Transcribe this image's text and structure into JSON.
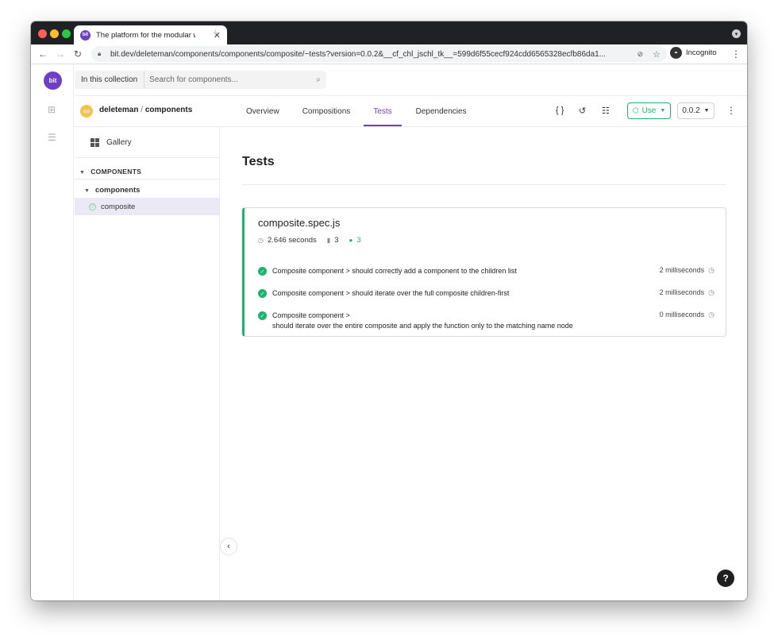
{
  "browser": {
    "tab_title": "The platform for the modular w",
    "tab_favicon": "bit",
    "url": "bit.dev/deleteman/components/components/composite/~tests?version=0.0.2&__cf_chl_jschl_tk__=599d6f55cecf924cdd6565328ecfb86da1...",
    "incognito_label": "Incognito"
  },
  "rail": {
    "logo": "bit"
  },
  "search": {
    "scope_label": "In this collection",
    "placeholder": "Search for components..."
  },
  "component": {
    "avatar": "co",
    "owner": "deleteman",
    "separator": "/",
    "collection": "components",
    "tabs": [
      "Overview",
      "Compositions",
      "Tests",
      "Dependencies"
    ],
    "active_tab": "Tests",
    "use_label": "Use",
    "version": "0.0.2"
  },
  "sidebar": {
    "gallery_label": "Gallery",
    "section_title": "COMPONENTS",
    "namespace": "components",
    "selected_component": "composite"
  },
  "main": {
    "page_title": "Tests",
    "test_file": {
      "name": "composite.spec.js",
      "duration": "2.646 seconds",
      "total": "3",
      "passed": "3",
      "tests": [
        {
          "name": "Composite component > should correctly add a component to the children list",
          "duration": "2 milliseconds"
        },
        {
          "name": "Composite component > should iterate over the full composite children-first",
          "duration": "2 milliseconds"
        },
        {
          "name_line1": "Composite component >",
          "name_line2": "should iterate over the entire composite and apply the function only to the matching name node",
          "duration": "0 milliseconds"
        }
      ]
    }
  },
  "help_label": "?",
  "colors": {
    "brand_purple": "#6c3fc6",
    "success_green": "#1cb36e",
    "avatar_yellow": "#f3c252"
  }
}
